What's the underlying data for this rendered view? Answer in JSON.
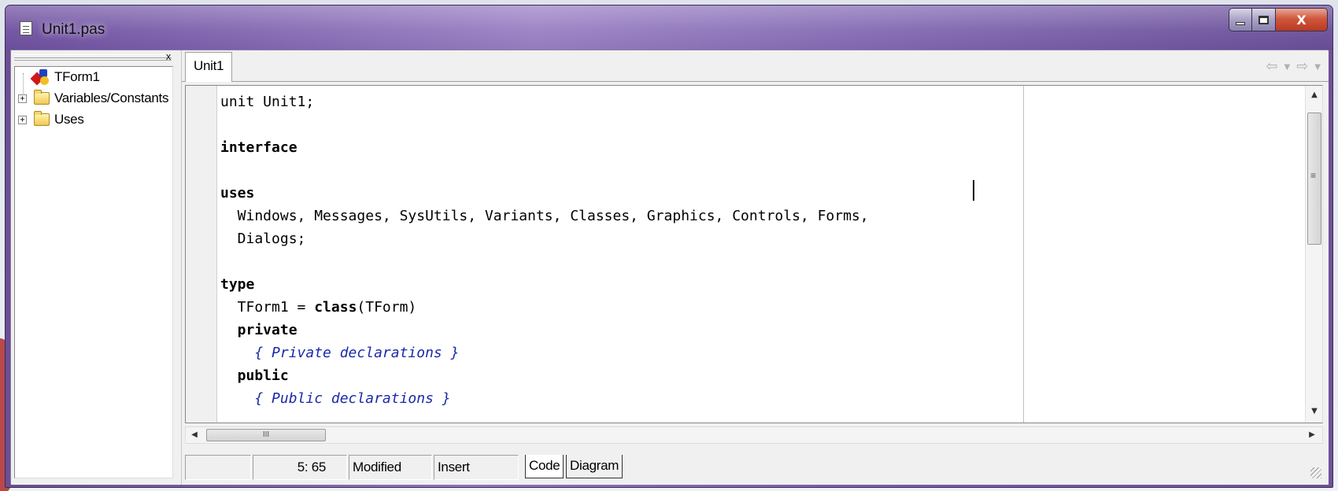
{
  "window": {
    "title": "Unit1.pas",
    "controls": {
      "minimize": "minimize",
      "maximize": "maximize",
      "close": "X"
    }
  },
  "explorer": {
    "close_glyph": "x",
    "tree": [
      {
        "label": "TForm1",
        "icon": "form-icon",
        "expandable": false
      },
      {
        "label": "Variables/Constants",
        "icon": "folder-icon",
        "expandable": true,
        "expander": "+"
      },
      {
        "label": "Uses",
        "icon": "folder-icon",
        "expandable": true,
        "expander": "+"
      }
    ]
  },
  "editor": {
    "tab_label": "Unit1",
    "nav": {
      "back": "⇦",
      "forward": "⇨",
      "dropdown": "▼"
    },
    "code_lines": [
      [
        {
          "t": "unit Unit1;",
          "c": "normal"
        }
      ],
      [],
      [
        {
          "t": "interface",
          "c": "kw"
        }
      ],
      [],
      [
        {
          "t": "uses",
          "c": "kw"
        }
      ],
      [
        {
          "t": "  Windows, Messages, SysUtils, Variants, Classes, Graphics, Controls, Forms,",
          "c": "normal"
        }
      ],
      [
        {
          "t": "  Dialogs;",
          "c": "normal"
        }
      ],
      [],
      [
        {
          "t": "type",
          "c": "kw"
        }
      ],
      [
        {
          "t": "  TForm1 = ",
          "c": "normal"
        },
        {
          "t": "class",
          "c": "kw"
        },
        {
          "t": "(TForm)",
          "c": "normal"
        }
      ],
      [
        {
          "t": "  private",
          "c": "kw"
        }
      ],
      [
        {
          "t": "    { Private declarations }",
          "c": "cm"
        }
      ],
      [
        {
          "t": "  public",
          "c": "kw"
        }
      ],
      [
        {
          "t": "    { Public declarations }",
          "c": "cm"
        }
      ]
    ],
    "scrollbar": {
      "up": "▲",
      "down": "▼",
      "left": "◀",
      "right": "▶",
      "thumb_glyph": "III"
    }
  },
  "statusbar": {
    "blank": "",
    "position": "5: 65",
    "modified": "Modified",
    "mode": "Insert",
    "tabs": [
      "Code",
      "Diagram"
    ]
  }
}
